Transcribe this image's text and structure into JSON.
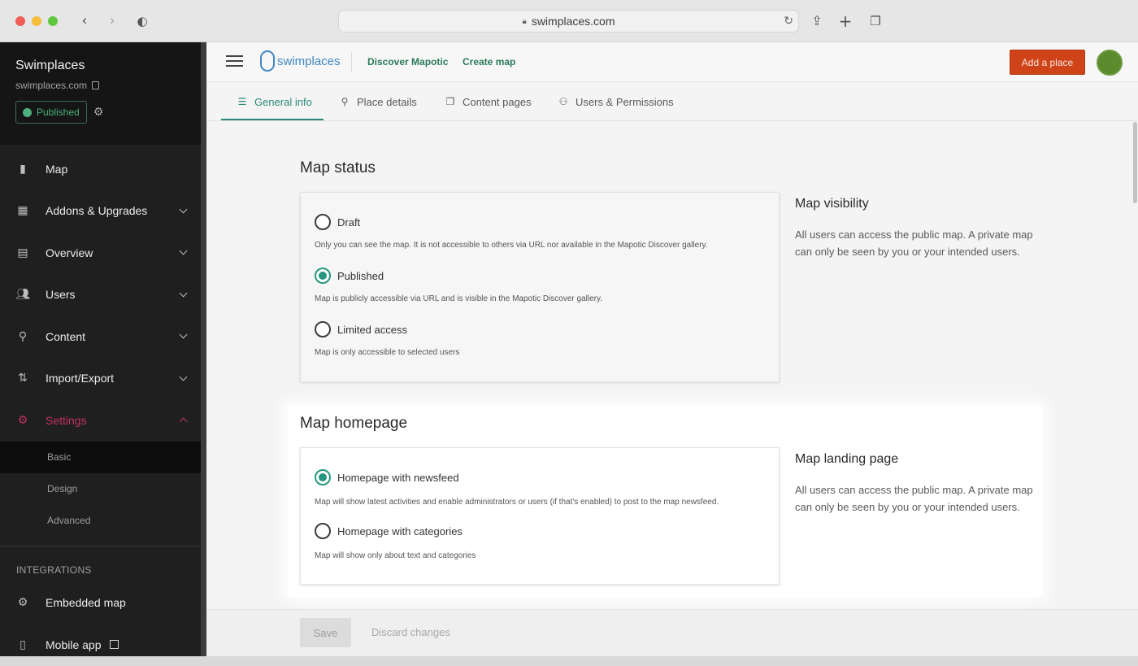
{
  "browser": {
    "url": "swimplaces.com",
    "icons": [
      "back-icon",
      "forward-icon",
      "shield-icon",
      "lock-icon",
      "reload-icon",
      "share-icon",
      "new-tab-icon",
      "tabs-icon"
    ]
  },
  "sidebar": {
    "title": "Swimplaces",
    "domain": "swimplaces.com",
    "status_badge": "Published",
    "items": [
      {
        "label": "Map",
        "icon": "map-icon",
        "expandable": false
      },
      {
        "label": "Addons & Upgrades",
        "icon": "addons-icon",
        "expandable": true
      },
      {
        "label": "Overview",
        "icon": "chart-icon",
        "expandable": true
      },
      {
        "label": "Users",
        "icon": "users-icon",
        "expandable": true
      },
      {
        "label": "Content",
        "icon": "pin-icon",
        "expandable": true
      },
      {
        "label": "Import/Export",
        "icon": "import-export-icon",
        "expandable": true
      },
      {
        "label": "Settings",
        "icon": "gear-icon",
        "expandable": true,
        "active": true
      }
    ],
    "settings_sub": [
      "Basic",
      "Design",
      "Advanced"
    ],
    "integrations_heading": "INTEGRATIONS",
    "integrations": [
      {
        "label": "Embedded map",
        "icon": "gear-icon"
      },
      {
        "label": "Mobile app",
        "icon": "mobile-icon"
      }
    ],
    "accent_color": "#c2315f"
  },
  "appbar": {
    "logo_text": "swimplaces",
    "links": [
      "Discover Mapotic",
      "Create map"
    ],
    "add_place": "Add a place"
  },
  "tabs": [
    {
      "label": "General info",
      "icon": "sliders-icon",
      "active": true
    },
    {
      "label": "Place details",
      "icon": "pin-icon"
    },
    {
      "label": "Content pages",
      "icon": "pages-icon"
    },
    {
      "label": "Users & Permissions",
      "icon": "user-permission-icon"
    }
  ],
  "map_status": {
    "title": "Map status",
    "options": [
      {
        "label": "Draft",
        "desc": "Only you can see the map. It is not accessible to others via URL nor available in the Mapotic Discover gallery.",
        "selected": false
      },
      {
        "label": "Published",
        "desc": "Map is publicly accessible via URL and is visible in the Mapotic Discover gallery.",
        "selected": true
      },
      {
        "label": "Limited access",
        "desc": "Map is only accessible to selected users",
        "selected": false
      }
    ],
    "side_title": "Map visibility",
    "side_text": "All users can access the public map. A private map can only be seen by you or your intended users."
  },
  "map_homepage": {
    "title": "Map homepage",
    "options": [
      {
        "label": "Homepage with newsfeed",
        "desc": "Map will show latest activities and enable administrators or users (if that's enabled) to post to the map newsfeed.",
        "selected": true
      },
      {
        "label": "Homepage with categories",
        "desc": "Map will show only about text and categories",
        "selected": false
      }
    ],
    "side_title": "Map landing page",
    "side_text": "All users can access the public map. A private map can only be seen by you or your intended users."
  },
  "footer": {
    "save": "Save",
    "discard": "Discard changes"
  },
  "colors": {
    "brand_green": "#25977f",
    "add_place_bg": "#cf4318"
  }
}
